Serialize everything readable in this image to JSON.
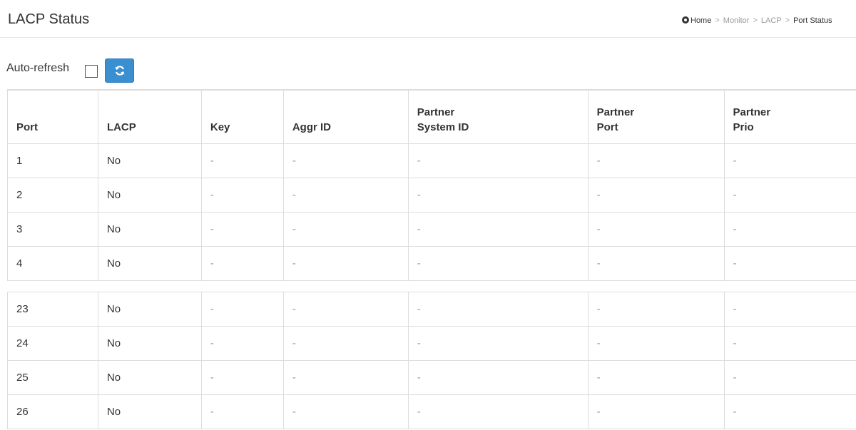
{
  "header": {
    "title": "LACP Status",
    "breadcrumb": {
      "home": "Home",
      "items": [
        "Monitor",
        "LACP"
      ],
      "current": "Port Status"
    }
  },
  "toolbar": {
    "auto_refresh_label": "Auto-refresh",
    "auto_refresh_checked": false,
    "refresh_icon": "refresh-icon"
  },
  "table": {
    "columns": [
      [
        "",
        "Port"
      ],
      [
        "",
        "LACP"
      ],
      [
        "",
        "Key"
      ],
      [
        "",
        "Aggr ID"
      ],
      [
        "Partner",
        "System ID"
      ],
      [
        "Partner",
        "Port"
      ],
      [
        "Partner",
        "Prio"
      ]
    ],
    "rows_top": [
      [
        "1",
        "No",
        "-",
        "-",
        "-",
        "-",
        "-"
      ],
      [
        "2",
        "No",
        "-",
        "-",
        "-",
        "-",
        "-"
      ],
      [
        "3",
        "No",
        "-",
        "-",
        "-",
        "-",
        "-"
      ],
      [
        "4",
        "No",
        "-",
        "-",
        "-",
        "-",
        "-"
      ]
    ],
    "rows_bottom": [
      [
        "23",
        "No",
        "-",
        "-",
        "-",
        "-",
        "-"
      ],
      [
        "24",
        "No",
        "-",
        "-",
        "-",
        "-",
        "-"
      ],
      [
        "25",
        "No",
        "-",
        "-",
        "-",
        "-",
        "-"
      ],
      [
        "26",
        "No",
        "-",
        "-",
        "-",
        "-",
        "-"
      ]
    ]
  }
}
